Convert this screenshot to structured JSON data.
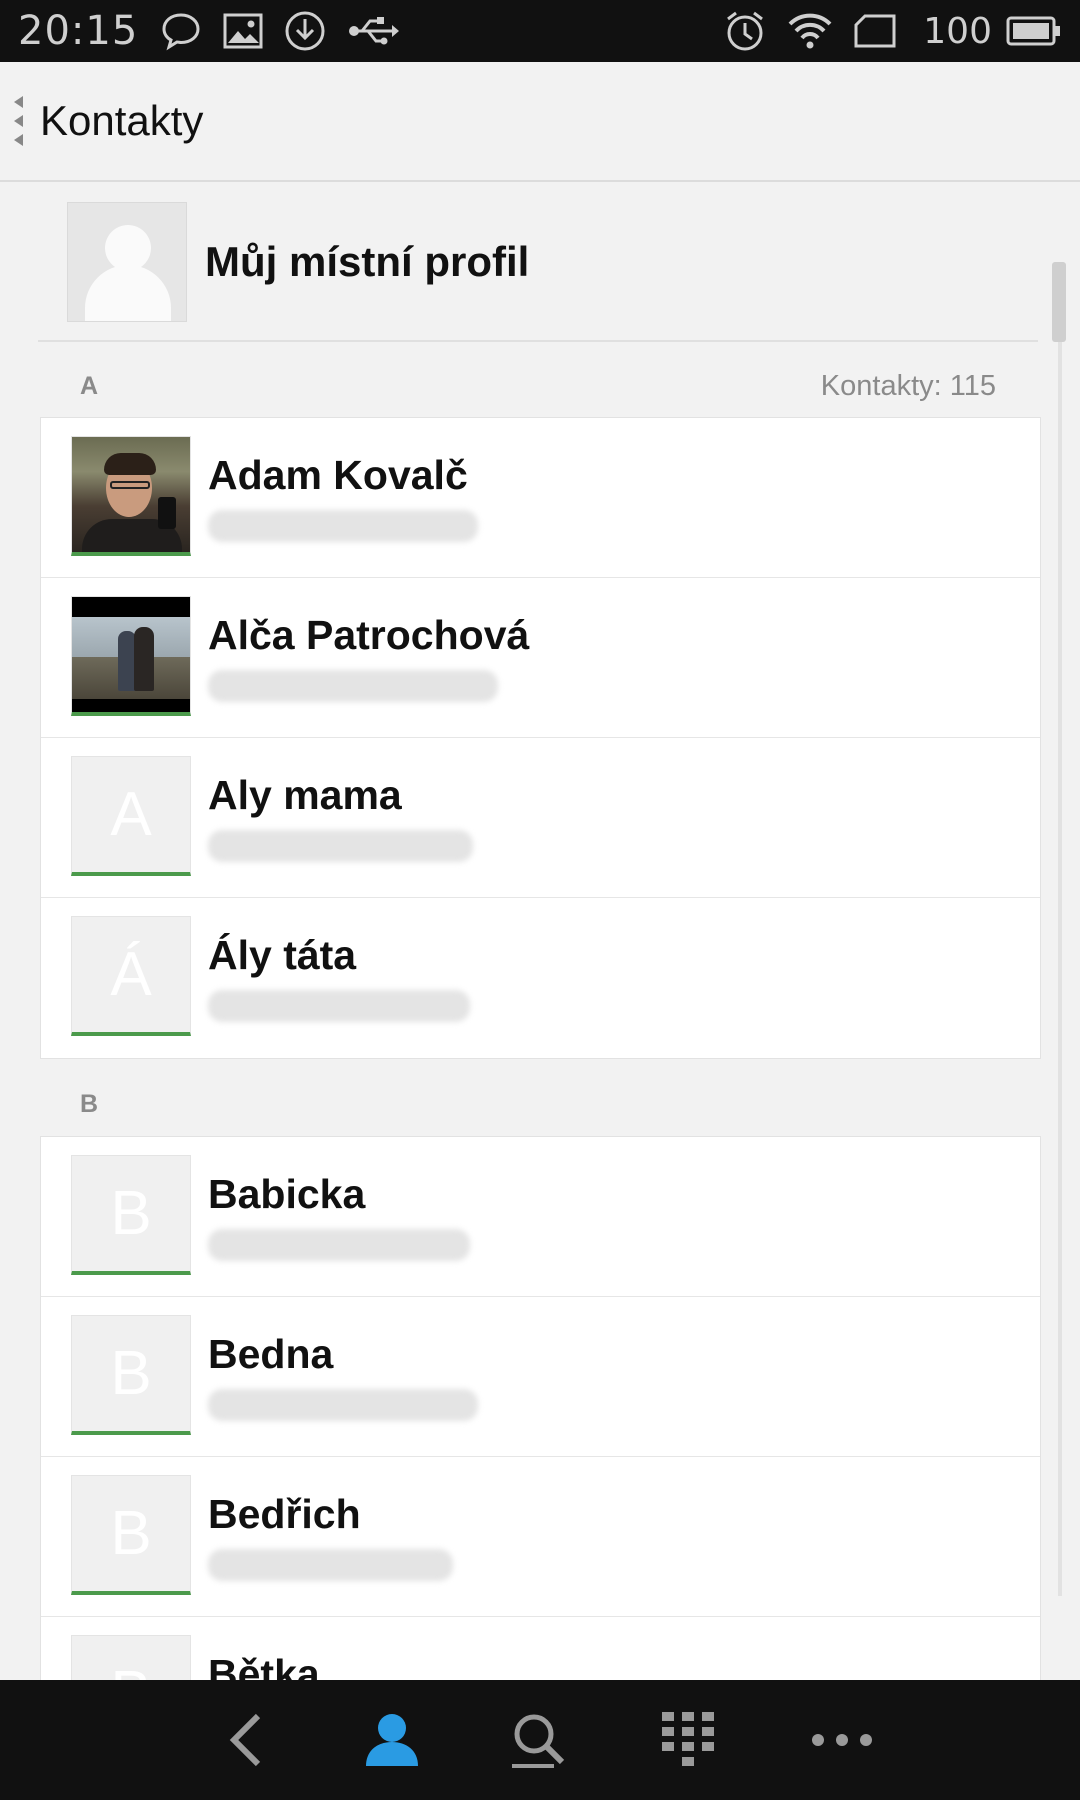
{
  "status_bar": {
    "time": "20:15",
    "battery_level": "100",
    "left_icons": [
      "chat-icon",
      "image-icon",
      "download-icon",
      "usb-icon"
    ],
    "right_icons": [
      "alarm-icon",
      "wifi-icon",
      "sim-icon",
      "battery-icon"
    ]
  },
  "header": {
    "title": "Kontakty"
  },
  "profile": {
    "label": "Můj místní profil"
  },
  "sections": [
    {
      "letter": "A",
      "count_label": "Kontakty: 115",
      "contacts": [
        {
          "name": "Adam Kovalč",
          "avatar": "photo",
          "initial": ""
        },
        {
          "name": "Alča Patrochová",
          "avatar": "photo",
          "initial": ""
        },
        {
          "name": "Aly mama",
          "avatar": "initial",
          "initial": "A"
        },
        {
          "name": "Ály táta",
          "avatar": "initial",
          "initial": "Á"
        }
      ]
    },
    {
      "letter": "B",
      "count_label": "",
      "contacts": [
        {
          "name": "Babicka",
          "avatar": "initial",
          "initial": "B"
        },
        {
          "name": "Bedna",
          "avatar": "initial",
          "initial": "B"
        },
        {
          "name": "Bedřich",
          "avatar": "initial",
          "initial": "B"
        },
        {
          "name": "Bětka",
          "avatar": "initial",
          "initial": "B"
        }
      ]
    }
  ],
  "bottom_nav": {
    "items": [
      "back-icon",
      "contacts-icon",
      "search-icon",
      "dialpad-icon",
      "more-icon"
    ],
    "active_color": "#2a9be3",
    "inactive_color": "#9a9a9a"
  },
  "colors": {
    "accent_green": "#4b9a4b"
  }
}
